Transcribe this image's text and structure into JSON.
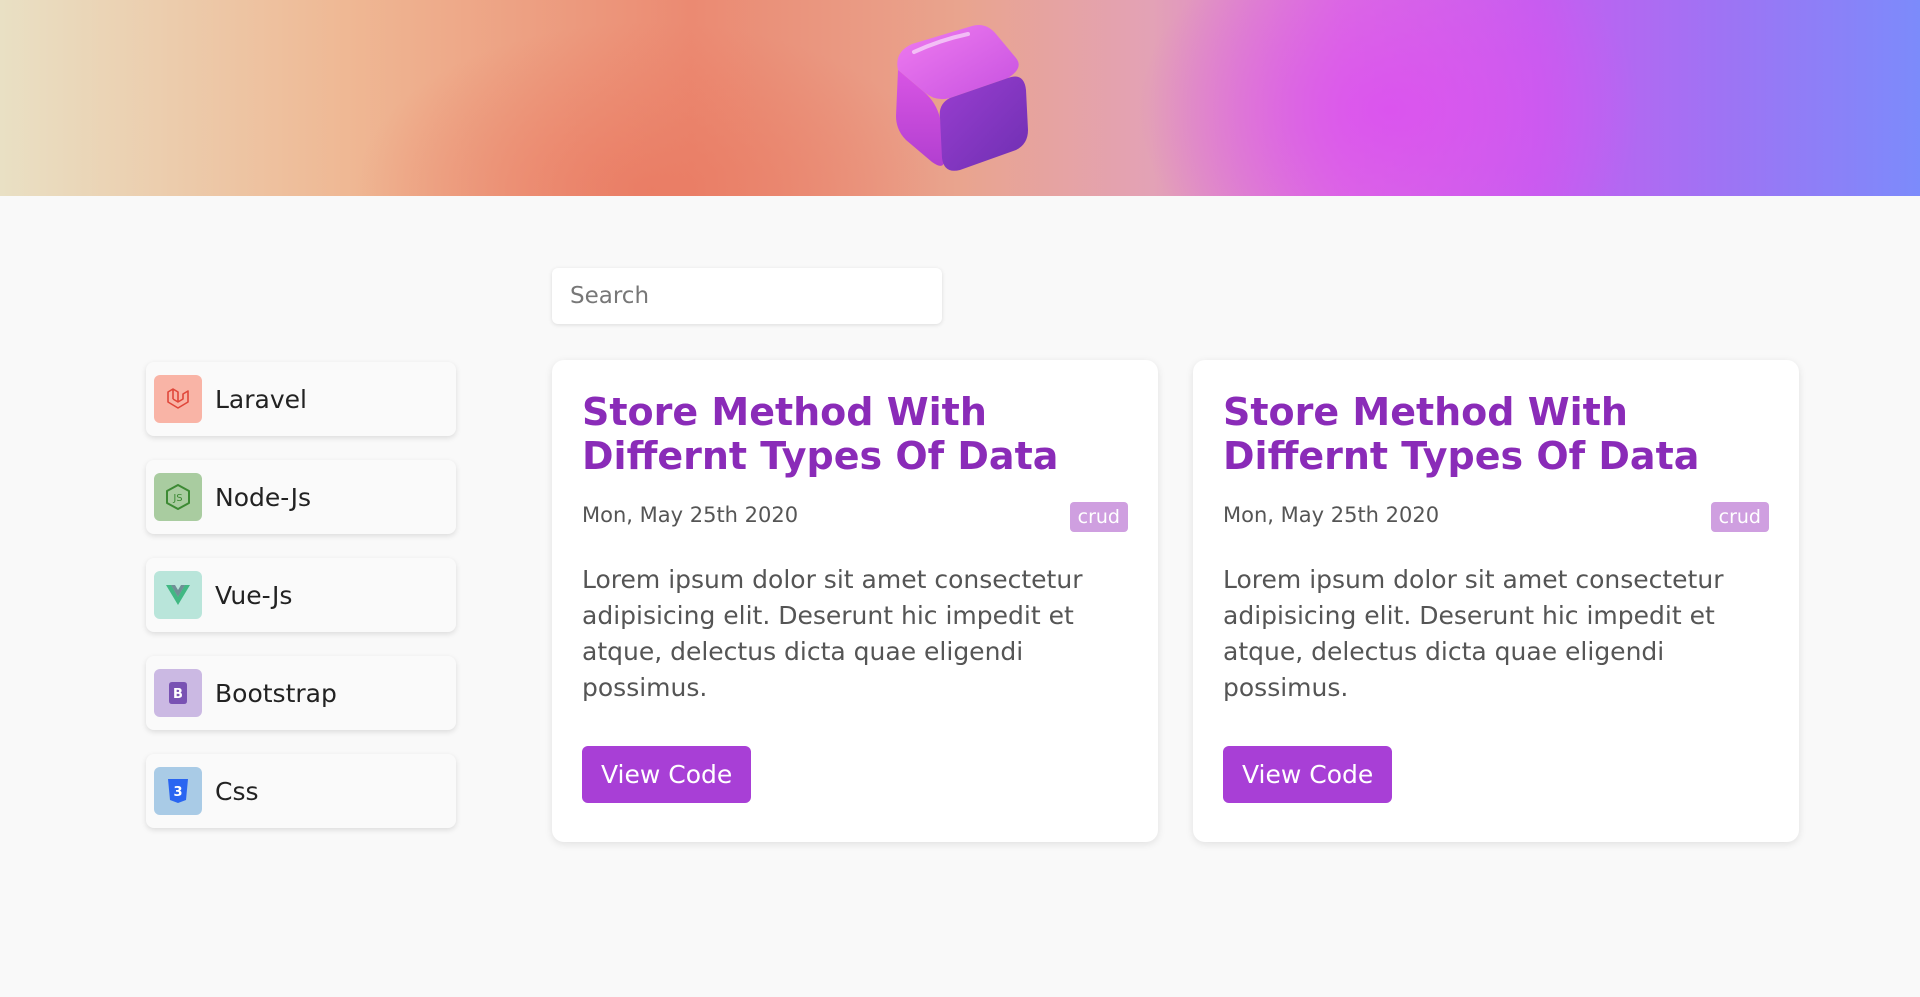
{
  "header": {
    "logo_icon": "purple-cube-icon",
    "gradient_colors": [
      "#e9e0c4",
      "#eb8a72",
      "#db6fe0",
      "#7c8bfb"
    ]
  },
  "search": {
    "placeholder": "Search",
    "value": ""
  },
  "sidebar": {
    "items": [
      {
        "label": "Laravel",
        "icon": "laravel-icon",
        "color": "#f9b4a6"
      },
      {
        "label": "Node-Js",
        "icon": "nodejs-icon",
        "color": "#a9cca0"
      },
      {
        "label": "Vue-Js",
        "icon": "vuejs-icon",
        "color": "#b9e5da"
      },
      {
        "label": "Bootstrap",
        "icon": "bootstrap-icon",
        "color": "#cbb9e3"
      },
      {
        "label": "Css",
        "icon": "css-icon",
        "color": "#a9cbe6"
      }
    ]
  },
  "posts": [
    {
      "title": "Store Method With Differnt Types Of Data",
      "date": "Mon, May 25th 2020",
      "tag": "crud",
      "excerpt": "Lorem ipsum dolor sit amet consectetur adipisicing elit. Deserunt hic impedit et atque, delectus dicta quae eligendi possimus.",
      "button_label": "View Code"
    },
    {
      "title": "Store Method With Differnt Types Of Data",
      "date": "Mon, May 25th 2020",
      "tag": "crud",
      "excerpt": "Lorem ipsum dolor sit amet consectetur adipisicing elit. Deserunt hic impedit et atque, delectus dicta quae eligendi possimus.",
      "button_label": "View Code"
    }
  ],
  "colors": {
    "accent": "#a83fd6",
    "title": "#8a2bb8",
    "badge": "#cf9fe0"
  }
}
